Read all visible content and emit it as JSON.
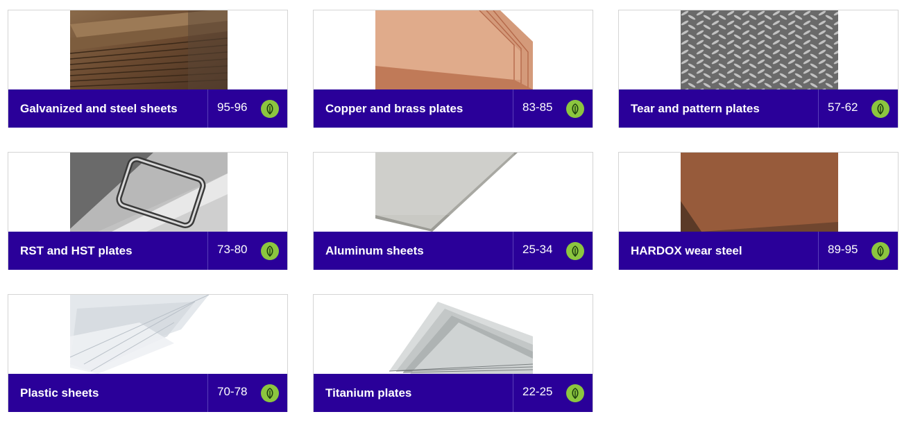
{
  "cards": [
    {
      "title": "Galvanized and steel sheets",
      "pages": "95-96",
      "image": "rusted-steel-sheets-stack",
      "icon": "leaf-icon"
    },
    {
      "title": "Copper and brass plates",
      "pages": "83-85",
      "image": "copper-plates-stack",
      "icon": "leaf-icon"
    },
    {
      "title": "Tear and pattern plates",
      "pages": "57-62",
      "image": "checker-plate",
      "icon": "leaf-icon"
    },
    {
      "title": "RST and HST plates",
      "pages": "73-80",
      "image": "steel-plates-with-frame",
      "icon": "leaf-icon"
    },
    {
      "title": "Aluminum sheets",
      "pages": "25-34",
      "image": "aluminum-sheet",
      "icon": "leaf-icon"
    },
    {
      "title": "HARDOX wear steel",
      "pages": "89-95",
      "image": "hardox-plate",
      "icon": "leaf-icon"
    },
    {
      "title": "Plastic sheets",
      "pages": "70-78",
      "image": "plastic-sheets",
      "icon": "leaf-icon"
    },
    {
      "title": "Titanium plates",
      "pages": "22-25",
      "image": "titanium-plates",
      "icon": "leaf-icon"
    }
  ],
  "colors": {
    "bar": "#2a0099",
    "leaf_badge": "#8cc63f",
    "text": "#ffffff"
  }
}
